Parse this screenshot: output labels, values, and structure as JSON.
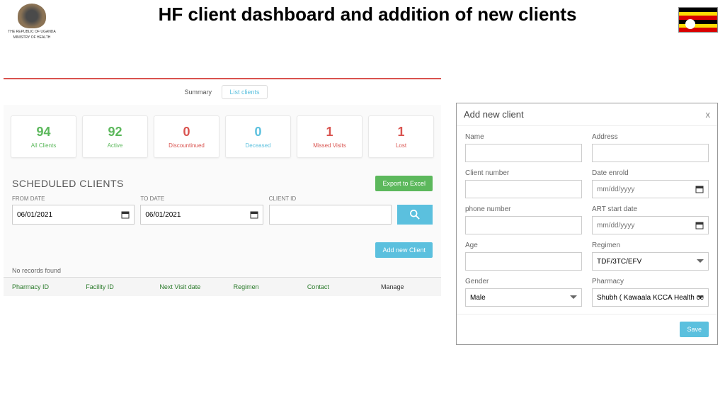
{
  "page_title": "HF client dashboard and addition of new clients",
  "logo_text1": "THE REPUBLIC OF UGANDA",
  "logo_text2": "MINISTRY OF HEALTH",
  "tabs": {
    "summary": "Summary",
    "list": "List clients"
  },
  "stats": [
    {
      "num": "94",
      "label": "All Clients",
      "cls": "green"
    },
    {
      "num": "92",
      "label": "Active",
      "cls": "green"
    },
    {
      "num": "0",
      "label": "Discountinued",
      "cls": "red"
    },
    {
      "num": "0",
      "label": "Deceased",
      "cls": "blue"
    },
    {
      "num": "1",
      "label": "Missed Visits",
      "cls": "red"
    },
    {
      "num": "1",
      "label": "Lost",
      "cls": "red"
    }
  ],
  "scheduled_title": "SCHEDULED CLIENTS",
  "export_btn": "Export to Excel",
  "filters": {
    "from_label": "FROM DATE",
    "from_value": "06/01/2021",
    "to_label": "TO DATE",
    "to_value": "06/01/2021",
    "client_label": "CLIENT ID"
  },
  "add_client_btn": "Add new Client",
  "no_records": "No records found",
  "columns": {
    "c1": "Pharmacy ID",
    "c2": "Facility ID",
    "c3": "Next Visit date",
    "c4": "Regimen",
    "c5": "Contact",
    "c6": "Manage"
  },
  "modal": {
    "title": "Add new client",
    "close": "x",
    "name": "Name",
    "address": "Address",
    "client_num": "Client number",
    "date_enrold": "Date enrold",
    "date_ph": "mm/dd/yyyy",
    "phone": "phone number",
    "art_start": "ART start date",
    "age": "Age",
    "regimen": "Regimen",
    "regimen_val": "TDF/3TC/EFV",
    "gender": "Gender",
    "gender_val": "Male",
    "pharmacy": "Pharmacy",
    "pharmacy_val": "Shubh ( Kawaala KCCA Health center IV )",
    "save": "Save"
  }
}
